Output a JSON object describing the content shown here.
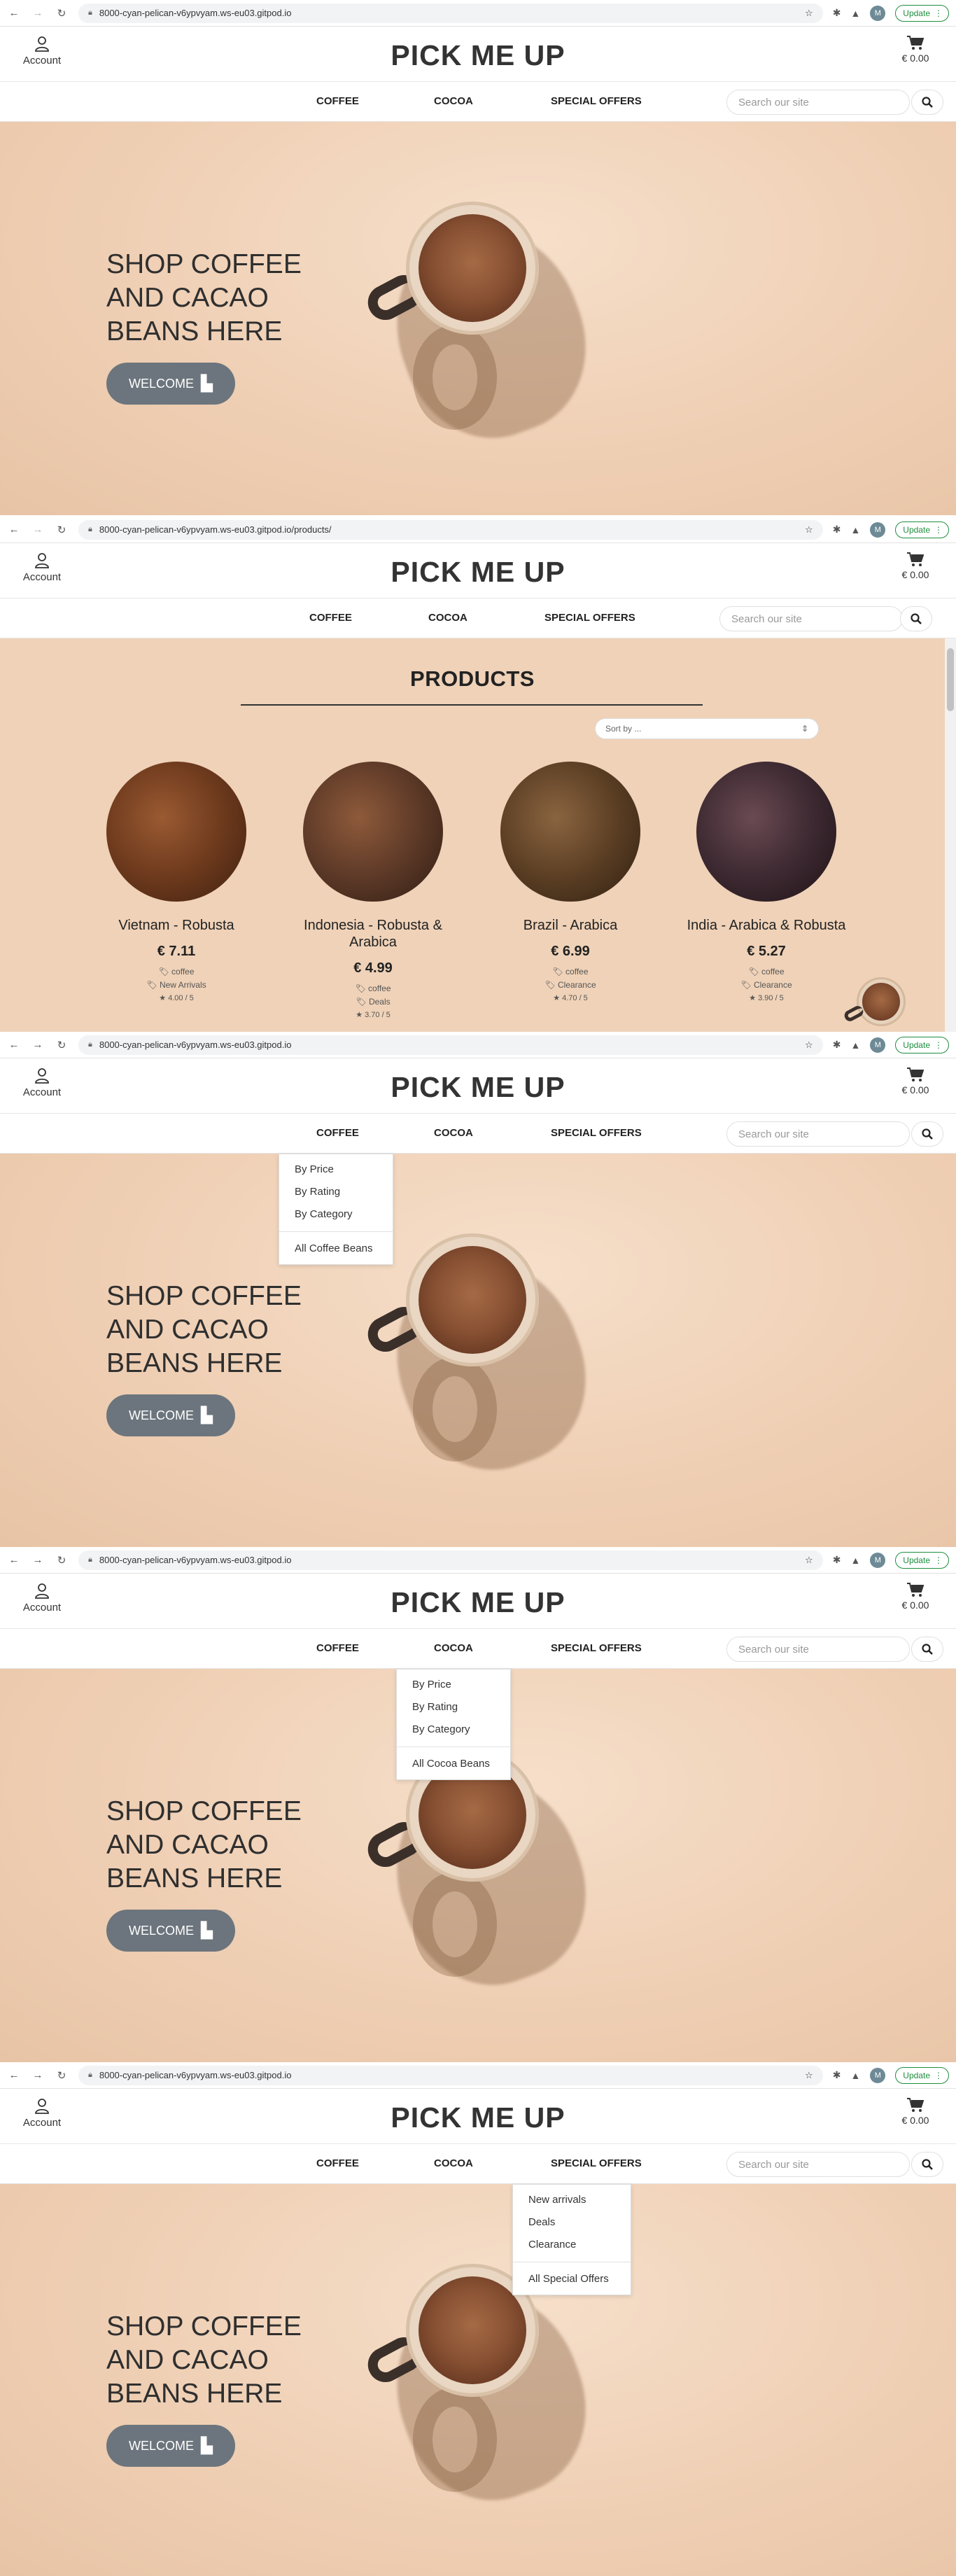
{
  "browser": {
    "url_home": "8000-cyan-pelican-v6ypvyam.ws-eu03.gitpod.io",
    "url_products": "8000-cyan-pelican-v6ypvyam.ws-eu03.gitpod.io/products/",
    "profile_initial": "M",
    "update_label": "Update"
  },
  "header": {
    "account_label": "Account",
    "logo": "PICK ME UP",
    "cart_total": "€ 0.00"
  },
  "nav": {
    "coffee": "COFFEE",
    "cocoa": "COCOA",
    "special": "SPECIAL OFFERS",
    "search_placeholder": "Search our site"
  },
  "hero": {
    "title": "SHOP COFFEE AND CACAO BEANS HERE",
    "button": "WELCOME"
  },
  "dropdowns": {
    "coffee": [
      "By Price",
      "By Rating",
      "By Category",
      "All Coffee Beans"
    ],
    "cocoa": [
      "By Price",
      "By Rating",
      "By Category",
      "All Cocoa Beans"
    ],
    "special": [
      "New arrivals",
      "Deals",
      "Clearance",
      "All Special Offers"
    ]
  },
  "products_page": {
    "title": "PRODUCTS",
    "sort_label": "Sort by ...",
    "products": [
      {
        "name": "Vietnam - Robusta",
        "price": "€ 7.11",
        "tag1": "coffee",
        "tag2": "New Arrivals",
        "rating": "4.00 / 5"
      },
      {
        "name": "Indonesia - Robusta & Arabica",
        "price": "€ 4.99",
        "tag1": "coffee",
        "tag2": "Deals",
        "rating": "3.70 / 5"
      },
      {
        "name": "Brazil - Arabica",
        "price": "€ 6.99",
        "tag1": "coffee",
        "tag2": "Clearance",
        "rating": "4.70 / 5"
      },
      {
        "name": "India - Arabica & Robusta",
        "price": "€ 5.27",
        "tag1": "coffee",
        "tag2": "Clearance",
        "rating": "3.90 / 5"
      }
    ]
  }
}
